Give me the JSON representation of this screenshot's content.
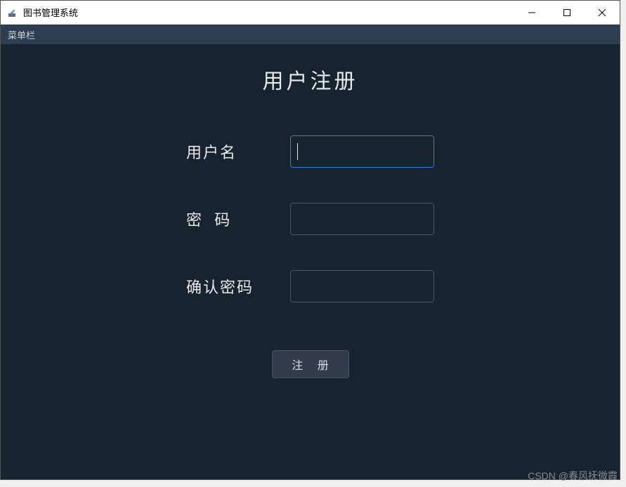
{
  "window": {
    "title": "图书管理系统"
  },
  "menubar": {
    "item": "菜单栏"
  },
  "form": {
    "title": "用户注册",
    "username_label": "用户名",
    "username_value": "",
    "password_label": "密  码",
    "password_value": "",
    "confirm_label": "确认密码",
    "confirm_value": "",
    "submit_label": "注 册"
  },
  "watermark": "CSDN @春风抚微霞"
}
